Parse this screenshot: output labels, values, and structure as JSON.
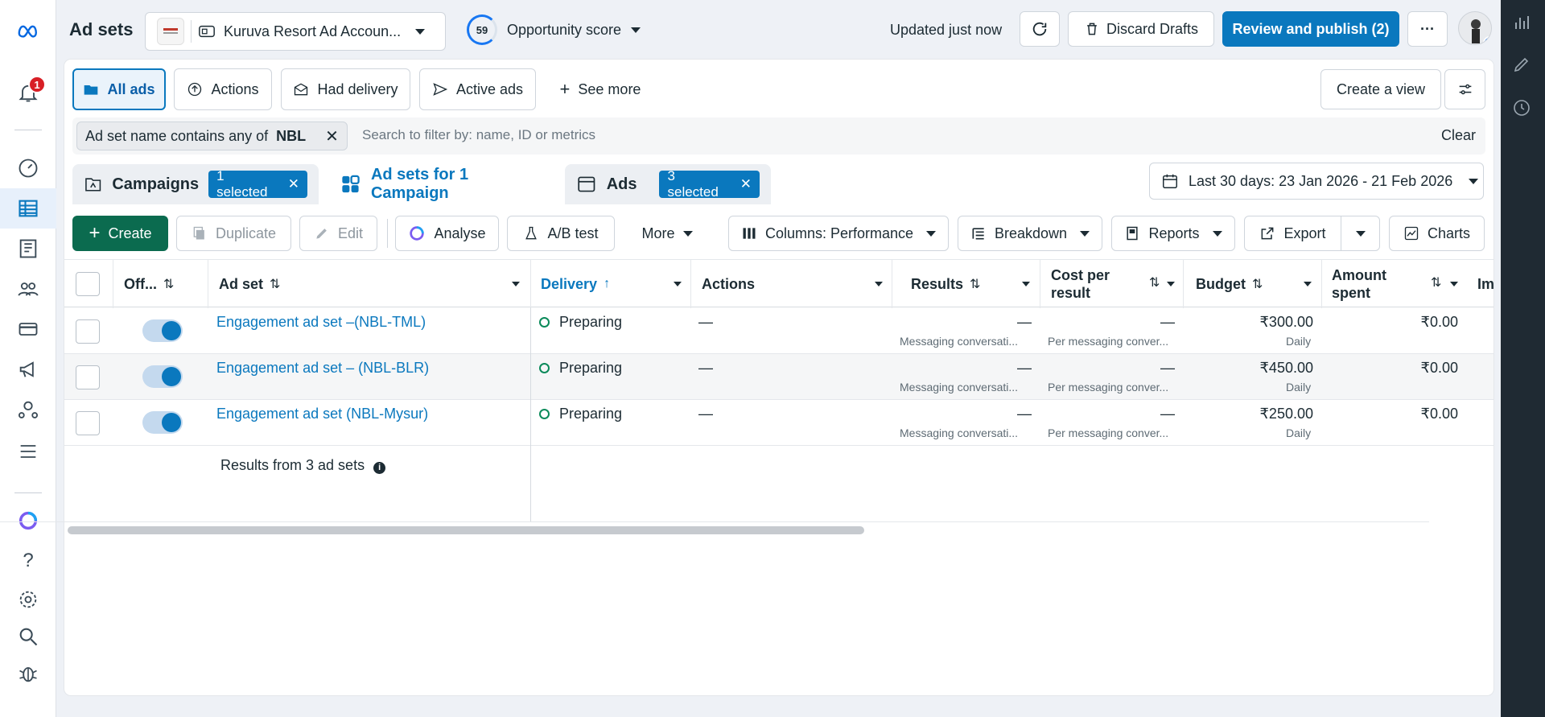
{
  "header": {
    "page_title": "Ad sets",
    "account_name": "Kuruva Resort Ad Accoun...",
    "opportunity_score": "59",
    "opportunity_label": "Opportunity score",
    "updated_text": "Updated just now",
    "discard_label": "Discard Drafts",
    "publish_label": "Review and publish (2)",
    "more_label": "···"
  },
  "leftnav": {
    "notification_count": "1"
  },
  "views": {
    "tabs": [
      {
        "label": "All ads"
      },
      {
        "label": "Actions"
      },
      {
        "label": "Had delivery"
      },
      {
        "label": "Active ads"
      },
      {
        "label": "See more"
      }
    ],
    "create_view_label": "Create a view"
  },
  "filter": {
    "chip_prefix": "Ad set name contains any of",
    "chip_value": "NBL",
    "search_placeholder": "Search to filter by: name, ID or metrics",
    "clear_label": "Clear"
  },
  "levels": {
    "campaigns_label": "Campaigns",
    "campaigns_selected": "1 selected",
    "adsets_label": "Ad sets for 1 Campaign",
    "ads_label": "Ads",
    "ads_selected": "3 selected"
  },
  "date_range": "Last 30 days: 23 Jan 2026 - 21 Feb 2026",
  "toolbar": {
    "create": "Create",
    "duplicate": "Duplicate",
    "edit": "Edit",
    "analyse": "Analyse",
    "ab_test": "A/B test",
    "more": "More",
    "columns": "Columns: Performance",
    "breakdown": "Breakdown",
    "reports": "Reports",
    "export": "Export",
    "charts": "Charts"
  },
  "table": {
    "headers": {
      "off": "Off...",
      "adset": "Ad set",
      "delivery": "Delivery",
      "actions": "Actions",
      "results": "Results",
      "cost_per_result_1": "Cost per",
      "cost_per_result_2": "result",
      "budget": "Budget",
      "amount_spent_1": "Amount",
      "amount_spent_2": "spent",
      "impressions_partial": "Im"
    },
    "rows": [
      {
        "name": "Engagement ad set –(NBL-TML)",
        "delivery": "Preparing",
        "actions": "—",
        "results": "—",
        "results_sub": "Messaging conversati...",
        "cpr": "—",
        "cpr_sub": "Per messaging conver...",
        "budget": "₹300.00",
        "budget_sub": "Daily",
        "spent": "₹0.00",
        "on": true
      },
      {
        "name": "Engagement ad set – (NBL-BLR)",
        "delivery": "Preparing",
        "actions": "—",
        "results": "—",
        "results_sub": "Messaging conversati...",
        "cpr": "—",
        "cpr_sub": "Per messaging conver...",
        "budget": "₹450.00",
        "budget_sub": "Daily",
        "spent": "₹0.00",
        "on": true
      },
      {
        "name": "Engagement ad set (NBL-Mysur)",
        "delivery": "Preparing",
        "actions": "—",
        "results": "—",
        "results_sub": "Messaging conversati...",
        "cpr": "—",
        "cpr_sub": "Per messaging conver...",
        "budget": "₹250.00",
        "budget_sub": "Daily",
        "spent": "₹0.00",
        "on": true
      }
    ],
    "footer": "Results from 3 ad sets"
  },
  "colors": {
    "accent": "#0a78be",
    "create_green": "#0b6b4f",
    "badge_red": "#d81f26",
    "rail_dark": "#1f2a33"
  }
}
